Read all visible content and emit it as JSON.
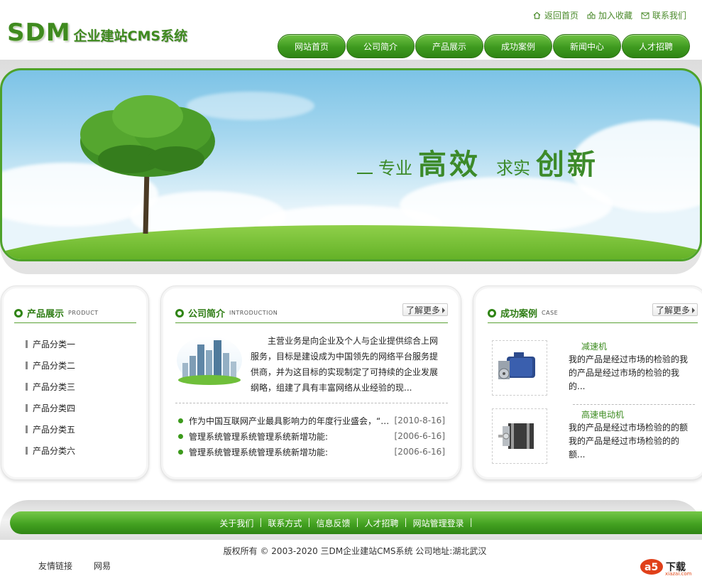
{
  "header": {
    "logo_sdm": "SDM",
    "logo_rest": "企业建站CMS系统",
    "toplinks": [
      {
        "label": "返回首页",
        "icon": "home-icon"
      },
      {
        "label": "加入收藏",
        "icon": "favorite-icon"
      },
      {
        "label": "联系我们",
        "icon": "mail-icon"
      }
    ],
    "nav": [
      "网站首页",
      "公司简介",
      "产品展示",
      "成功案例",
      "新闻中心",
      "人才招聘"
    ]
  },
  "banner": {
    "slogan_1": "专业",
    "slogan_2": "高效",
    "slogan_3": "求实",
    "slogan_4": "创新"
  },
  "product_panel": {
    "title": "产品展示",
    "subtitle": "PRODUCT",
    "categories": [
      "产品分类一",
      "产品分类二",
      "产品分类三",
      "产品分类四",
      "产品分类五",
      "产品分类六"
    ]
  },
  "about_panel": {
    "title": "公司简介",
    "subtitle": "INTRODUCTION",
    "more": "了解更多",
    "text": "主营业务是向企业及个人与企业提供综合上网服务，目标是建设成为中国领先的网络平台服务提供商，并为这目标的实现制定了可持续的企业发展纲略，组建了具有丰富网络从业经验的现...",
    "news": [
      {
        "title": "作为中国互联网产业最具影响力的年度行业盛会，“…",
        "date": "[2010-8-16]"
      },
      {
        "title": "管理系统管理系统管理系统新增功能:",
        "date": "[2006-6-16]"
      },
      {
        "title": "管理系统管理系统管理系统新增功能:",
        "date": "[2006-6-16]"
      }
    ]
  },
  "case_panel": {
    "title": "成功案例",
    "subtitle": "CASE",
    "more": "了解更多",
    "items": [
      {
        "name": "减速机",
        "desc": "我的产品是经过市场的检验的我的产品是经过市场的检验的我的..."
      },
      {
        "name": "高速电动机",
        "desc": "我的产品是经过市场检验的的额我的产品是经过市场检验的的额..."
      }
    ]
  },
  "footer": {
    "links": [
      "关于我们",
      "联系方式",
      "信息反馈",
      "人才招聘",
      "网站管理登录"
    ],
    "copyright": "版权所有 © 2003-2020 三DM企业建站CMS系统 公司地址:湖北武汉",
    "friend_label": "友情链接",
    "friend_links": [
      "网易"
    ],
    "watermark_text": "下载",
    "watermark_domain": "xiazai.com"
  },
  "colors": {
    "brand_green": "#3f8a1f",
    "nav_green": "#3e9a1f",
    "text_dark": "#222222"
  }
}
